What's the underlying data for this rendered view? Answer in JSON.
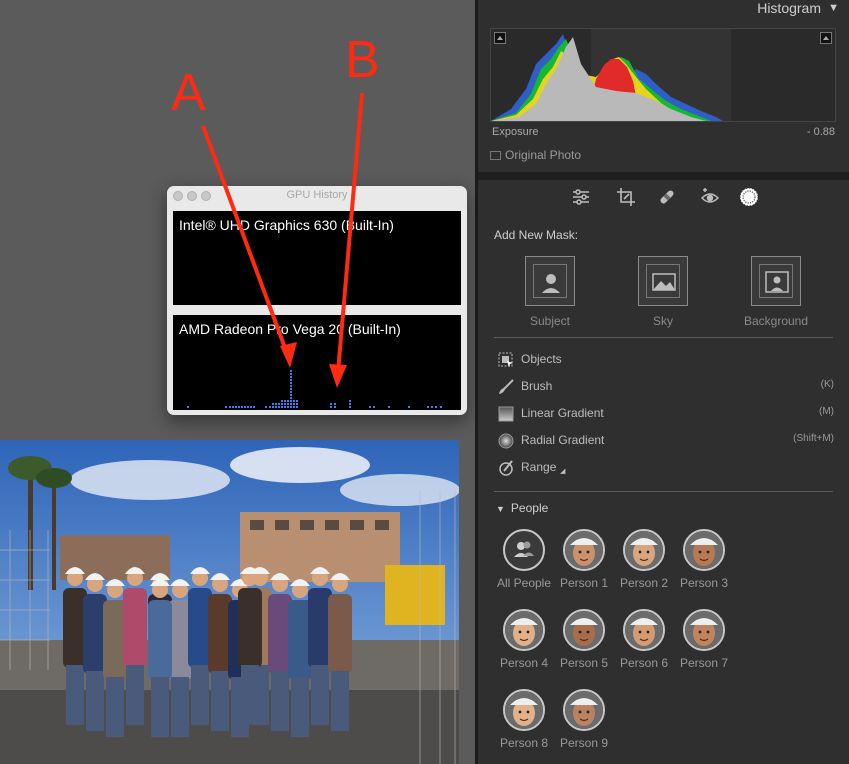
{
  "annotations": {
    "a": "A",
    "b": "B"
  },
  "gpu_window": {
    "title": "GPU History",
    "gpus": [
      {
        "label": "Intel® UHD Graphics 630 (Built-In)"
      },
      {
        "label": "AMD Radeon Pro Vega 20 (Built-In)"
      }
    ]
  },
  "histogram": {
    "title": "Histogram",
    "exposure_label": "Exposure",
    "exposure_value": "- 0.88",
    "original_photo_label": "Original Photo"
  },
  "masking": {
    "add_new_mask": "Add New Mask:",
    "mask_buttons": [
      {
        "label": "Subject"
      },
      {
        "label": "Sky"
      },
      {
        "label": "Background"
      }
    ],
    "tools": [
      {
        "label": "Objects",
        "key": ""
      },
      {
        "label": "Brush",
        "key": "(K)"
      },
      {
        "label": "Linear Gradient",
        "key": "(M)"
      },
      {
        "label": "Radial Gradient",
        "key": "(Shift+M)"
      },
      {
        "label": "Range",
        "key": ""
      }
    ]
  },
  "people": {
    "header": "People",
    "items": [
      {
        "label": "All People"
      },
      {
        "label": "Person 1"
      },
      {
        "label": "Person 2"
      },
      {
        "label": "Person 3"
      },
      {
        "label": "Person 4"
      },
      {
        "label": "Person 5"
      },
      {
        "label": "Person 6"
      },
      {
        "label": "Person 7"
      },
      {
        "label": "Person 8"
      },
      {
        "label": "Person 9"
      }
    ]
  },
  "colors": {
    "panel_bg": "#2f2f2f",
    "canvas_bg": "#5b5b5b",
    "annotation_red": "#ff2a12",
    "gpu_bar_blue": "#3c7ff5"
  }
}
